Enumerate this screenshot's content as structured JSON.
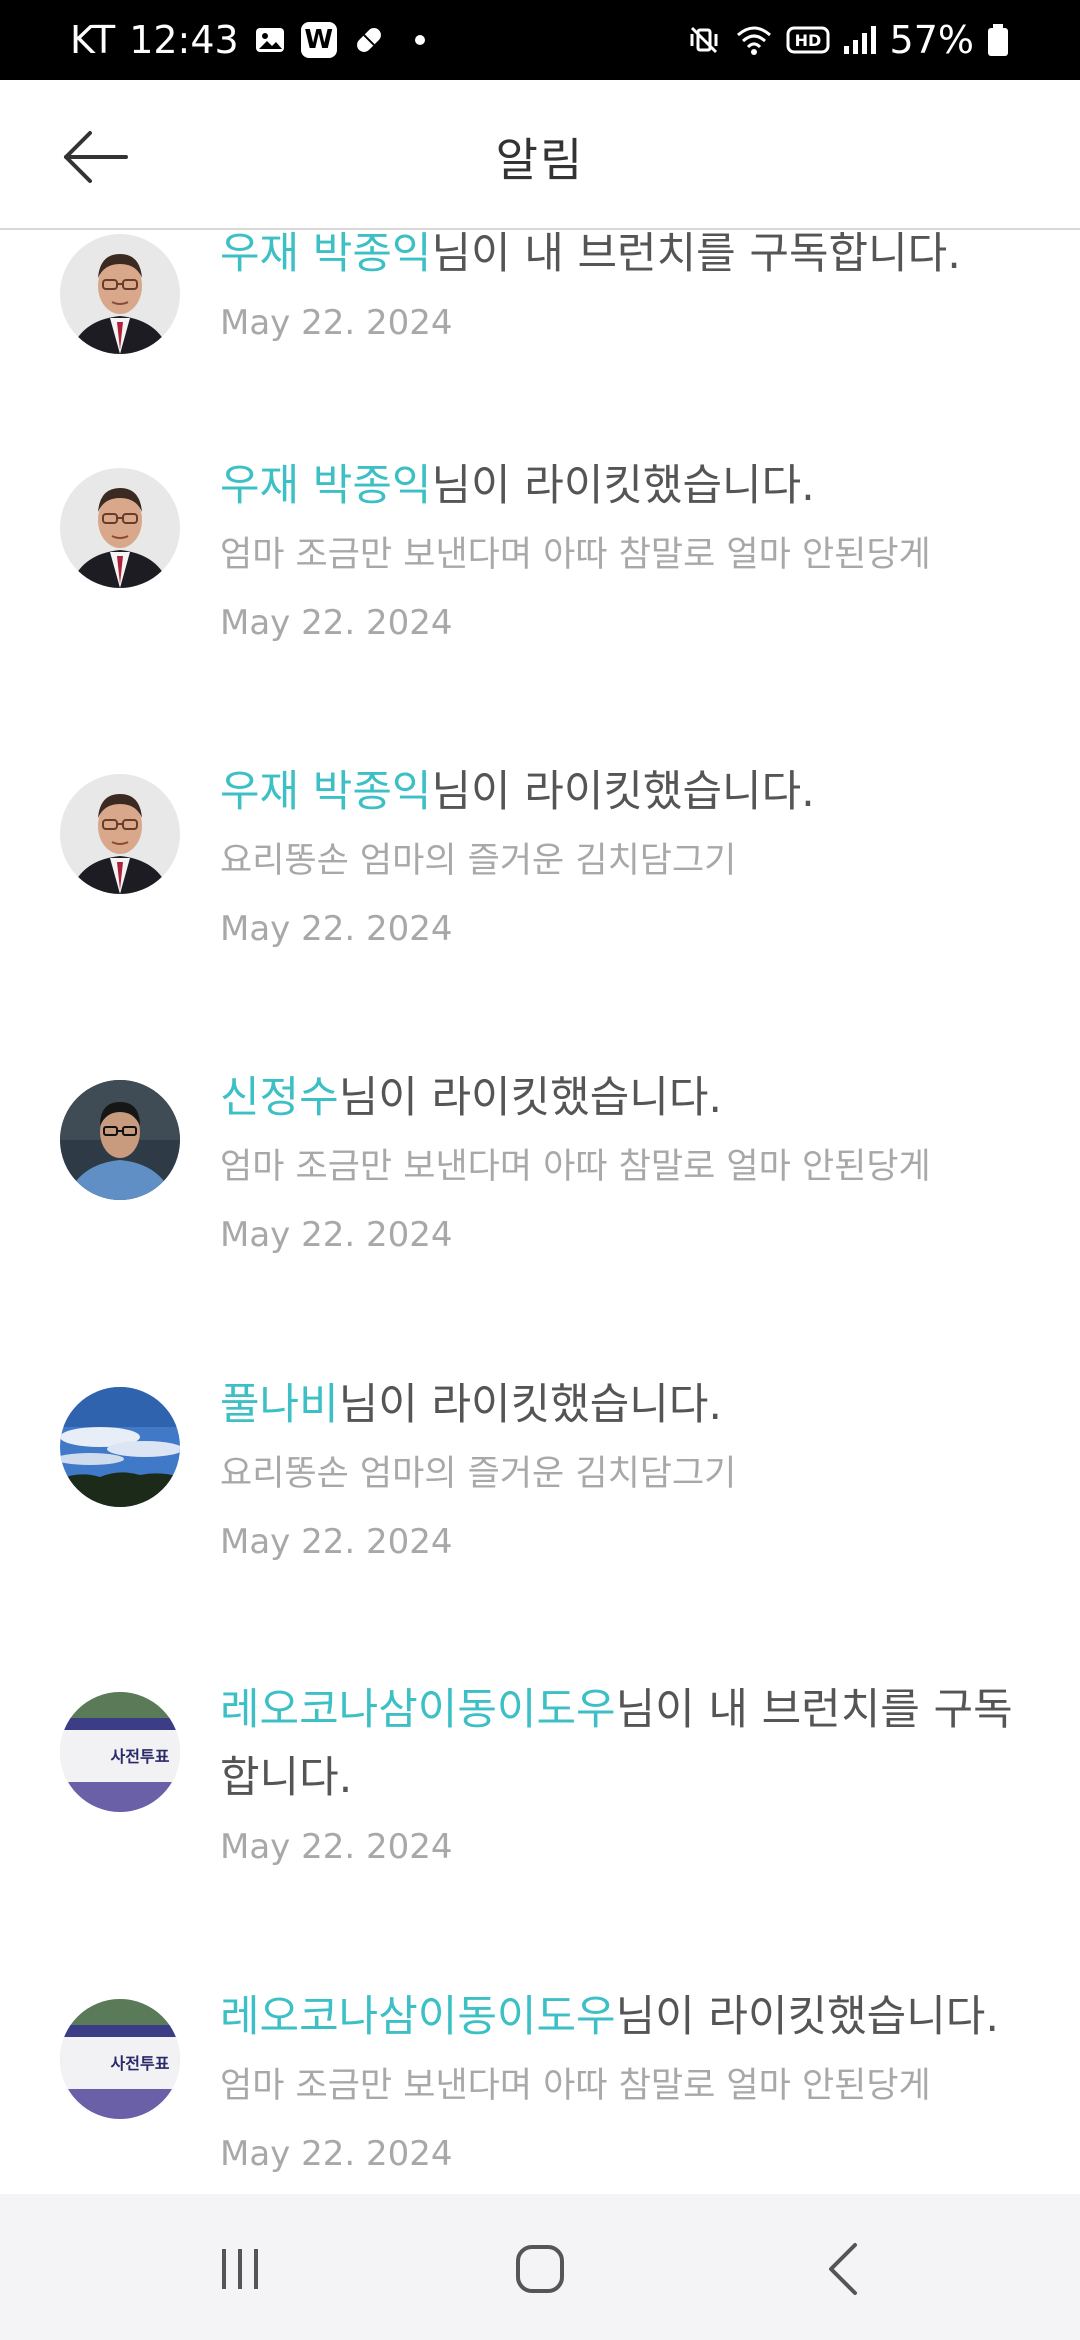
{
  "status_bar": {
    "carrier": "KT",
    "time": "12:43",
    "battery": "57%",
    "left_icons": [
      "image-icon",
      "w-app-icon",
      "pill-icon",
      "dot-icon"
    ],
    "right_icons": [
      "mute-vibrate-icon",
      "wifi-icon",
      "hd-icon",
      "signal-icon",
      "battery-icon"
    ]
  },
  "header": {
    "title": "알림"
  },
  "notifications": [
    {
      "user": "우재 박종익",
      "action": "님이 내 브런치를 구독합니다.",
      "detail": "",
      "date": "May 22. 2024",
      "avatar": "man-glasses-suit"
    },
    {
      "user": "우재 박종익",
      "action": "님이 라이킷했습니다.",
      "detail": "엄마 조금만 보낸다며 아따 참말로 얼마 안된당게",
      "date": "May 22. 2024",
      "avatar": "man-glasses-suit"
    },
    {
      "user": "우재 박종익",
      "action": "님이 라이킷했습니다.",
      "detail": "요리똥손 엄마의 즐거운 김치담그기",
      "date": "May 22. 2024",
      "avatar": "man-glasses-suit"
    },
    {
      "user": "신정수",
      "action": "님이 라이킷했습니다.",
      "detail": "엄마 조금만 보낸다며 아따 참말로 얼마 안된당게",
      "date": "May 22. 2024",
      "avatar": "man-blue-shirt"
    },
    {
      "user": "풀나비",
      "action": "님이 라이킷했습니다.",
      "detail": "요리똥손 엄마의 즐거운 김치담그기",
      "date": "May 22. 2024",
      "avatar": "sky-landscape"
    },
    {
      "user": "레오코나삼이동이도우",
      "action": "님이 내 브런치를 구독합니다.",
      "detail": "",
      "date": "May 22. 2024",
      "avatar": "banner-sign"
    },
    {
      "user": "레오코나삼이동이도우",
      "action": "님이 라이킷했습니다.",
      "detail": "엄마 조금만 보낸다며 아따 참말로 얼마 안된당게",
      "date": "May 22. 2024",
      "avatar": "banner-sign"
    }
  ],
  "avatar_signs": {
    "banner_text": "사전투표"
  },
  "nav_bar": {
    "buttons": [
      "recent-apps-icon",
      "home-icon",
      "back-nav-icon"
    ]
  },
  "colors": {
    "accent": "#3cc0c5",
    "text": "#555555",
    "muted": "#a8a8a8"
  }
}
